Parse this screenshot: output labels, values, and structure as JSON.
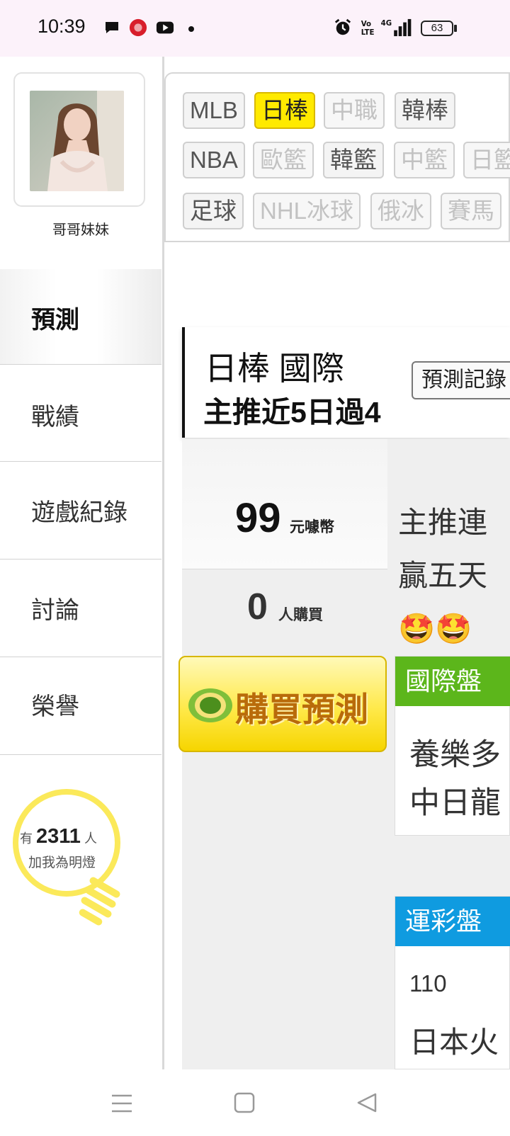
{
  "status_bar": {
    "time": "10:39",
    "battery": "63",
    "icons": [
      "chat-bubble-icon",
      "app-badge-icon",
      "youtube-icon",
      "dot-icon",
      "alarm-icon",
      "volte-icon",
      "signal-4g-icon",
      "battery-icon"
    ]
  },
  "profile": {
    "name": "哥哥妹妹"
  },
  "nav": {
    "predict": "預測",
    "record": "戰績",
    "game_log": "遊戲紀錄",
    "discuss": "討論",
    "honor": "榮譽"
  },
  "bulb": {
    "prefix": "有",
    "count": "2311",
    "suffix": "人",
    "line2": "加我為明燈"
  },
  "filters": {
    "row1": [
      "MLB",
      "日棒",
      "中職",
      "韓棒"
    ],
    "row2": [
      "NBA",
      "歐籃",
      "韓籃",
      "中籃",
      "日籃"
    ],
    "row3": [
      "足球",
      "NHL冰球",
      "俄冰",
      "賽馬"
    ],
    "selected": "日棒"
  },
  "header": {
    "league": "日棒 國際",
    "streak": "主推近5日過4",
    "history_button": "預測記錄"
  },
  "price": {
    "amount": "99",
    "unit": "元噱幣",
    "buyers": "0",
    "buyers_unit": "人購買"
  },
  "buy_button": {
    "label": "購買預測"
  },
  "description": {
    "line1": "主推連",
    "line2": "贏五天",
    "line3": "🤩🤩"
  },
  "intl_panel": {
    "title": "國際盤",
    "line1": "養樂多",
    "line2": "中日龍"
  },
  "sport_panel": {
    "title": "運彩盤",
    "number": "110",
    "team": "日本火"
  },
  "colors": {
    "selected_chip": "#ffea00",
    "intl_header": "#5cb61b",
    "sport_header": "#0f9be0",
    "status_bar_bg": "#fcf2fa"
  }
}
